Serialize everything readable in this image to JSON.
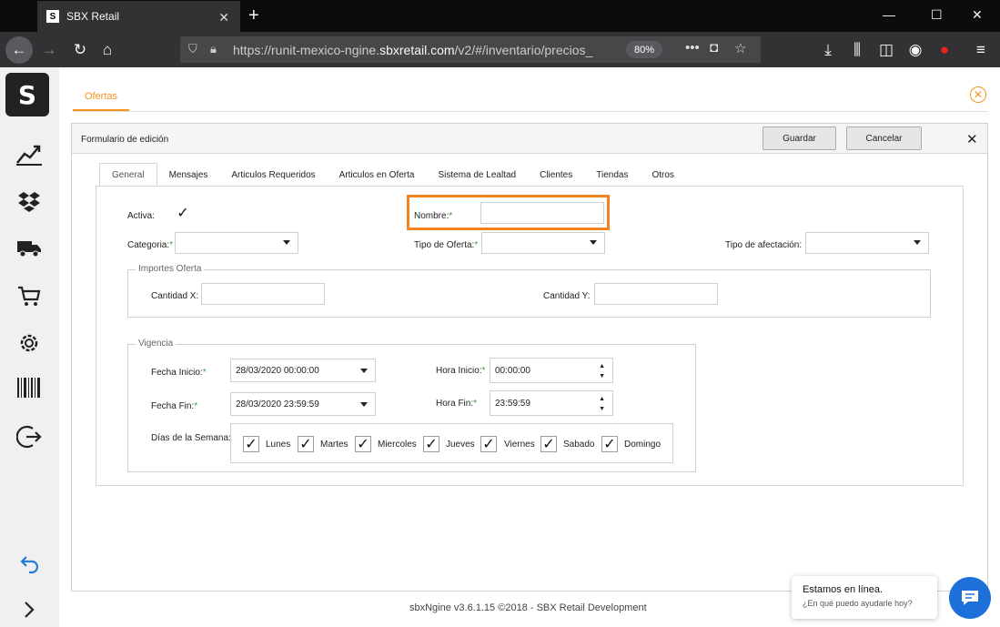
{
  "browser": {
    "tab_title": "SBX Retail",
    "url_prefix": "https://runit-mexico-ngine.",
    "url_host": "sbxretail.com",
    "url_path": "/v2/#/inventario/precios_",
    "zoom": "80%"
  },
  "app": {
    "tab_label": "Ofertas",
    "panel_title": "Formulario de edición",
    "save_label": "Guardar",
    "cancel_label": "Cancelar",
    "accent_color": "#f7941d"
  },
  "tabs": [
    "General",
    "Mensajes",
    "Articulos Requeridos",
    "Articulos en Oferta",
    "Sistema de Lealtad",
    "Clientes",
    "Tiendas",
    "Otros"
  ],
  "form": {
    "activa_label": "Activa:",
    "nombre_label": "Nombre:",
    "categoria_label": "Categoria:",
    "tipo_oferta_label": "Tipo de Oferta:",
    "tipo_afectacion_label": "Tipo de afectación:",
    "importes_legend": "Importes Oferta",
    "cantidad_x_label": "Cantidad X:",
    "cantidad_y_label": "Cantidad Y:",
    "vigencia_legend": "Vigencia",
    "fecha_inicio_label": "Fecha Inicio:",
    "fecha_inicio_value": "28/03/2020 00:00:00",
    "fecha_fin_label": "Fecha Fin:",
    "fecha_fin_value": "28/03/2020 23:59:59",
    "hora_inicio_label": "Hora Inicio:",
    "hora_inicio_value": "00:00:00",
    "hora_fin_label": "Hora Fin:",
    "hora_fin_value": "23:59:59",
    "dias_label": "Días de la Semana:",
    "required_mark": "*"
  },
  "days": [
    "Lunes",
    "Martes",
    "Miercoles",
    "Jueves",
    "Viernes",
    "Sabado",
    "Domingo"
  ],
  "footer": "sbxNgine v3.6.1.15 ©2018 - SBX Retail Development",
  "chat": {
    "title": "Estamos en línea.",
    "subtitle": "¿En qué puedo ayudarle hoy?"
  }
}
